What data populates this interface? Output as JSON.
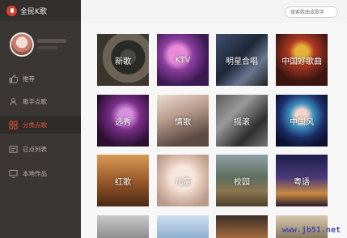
{
  "app": {
    "name": "全民K歌"
  },
  "search": {
    "placeholder": "搜索歌曲或歌手"
  },
  "nav": [
    {
      "label": "推荐",
      "icon": "thumbs-up-icon"
    },
    {
      "label": "歌手点歌",
      "icon": "person-icon"
    },
    {
      "label": "分类点歌",
      "icon": "grid-icon",
      "active": true
    },
    {
      "label": "已点列表",
      "icon": "list-icon"
    },
    {
      "label": "本地作品",
      "icon": "monitor-icon"
    }
  ],
  "categories": [
    {
      "label": "新歌"
    },
    {
      "label": "KTV"
    },
    {
      "label": "明星合唱"
    },
    {
      "label": "中国好歌曲"
    },
    {
      "label": "选秀"
    },
    {
      "label": "情歌"
    },
    {
      "label": "摇滚"
    },
    {
      "label": "中国风"
    },
    {
      "label": "红歌"
    },
    {
      "label": "儿童"
    },
    {
      "label": "校园"
    },
    {
      "label": "粤语"
    },
    {
      "label": ""
    },
    {
      "label": ""
    },
    {
      "label": ""
    },
    {
      "label": ""
    }
  ],
  "watermark": "www.jb51.net",
  "colors": {
    "accent": "#e0553a",
    "sidebar": "#3a3634"
  }
}
